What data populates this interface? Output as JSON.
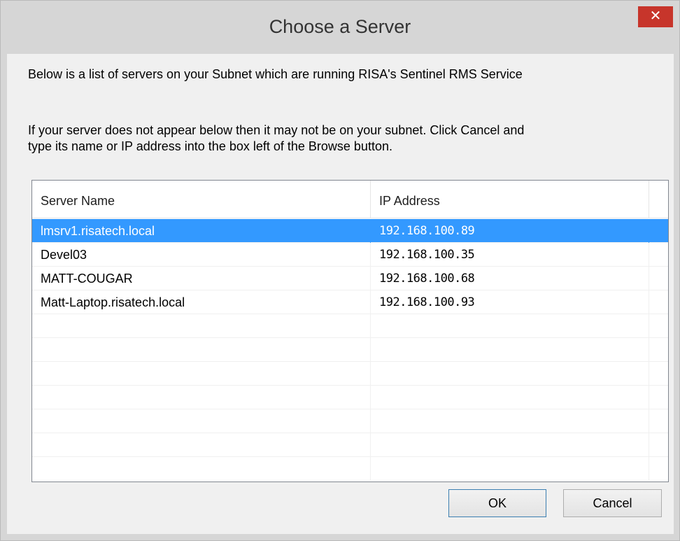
{
  "window": {
    "title": "Choose a Server",
    "close_glyph": "✕",
    "close_icon": "close-icon"
  },
  "messages": {
    "intro": "Below is a list of servers on your Subnet which are running RISA's Sentinel RMS Service",
    "hint_line1": "If your server does not appear below then it may not be on your subnet. Click Cancel and",
    "hint_line2": "type its name or IP address into the box left of the Browse button."
  },
  "list": {
    "columns": [
      "Server Name",
      "IP Address"
    ],
    "rows": [
      {
        "name": "lmsrv1.risatech.local",
        "ip": "192.168.100.89",
        "selected": true
      },
      {
        "name": "Devel03",
        "ip": "192.168.100.35",
        "selected": false
      },
      {
        "name": "MATT-COUGAR",
        "ip": "192.168.100.68",
        "selected": false
      },
      {
        "name": "Matt-Laptop.risatech.local",
        "ip": "192.168.100.93",
        "selected": false
      },
      {
        "name": "",
        "ip": "",
        "selected": false
      },
      {
        "name": "",
        "ip": "",
        "selected": false
      },
      {
        "name": "",
        "ip": "",
        "selected": false
      },
      {
        "name": "",
        "ip": "",
        "selected": false
      },
      {
        "name": "",
        "ip": "",
        "selected": false
      },
      {
        "name": "",
        "ip": "",
        "selected": false
      },
      {
        "name": "",
        "ip": "",
        "selected": false
      }
    ]
  },
  "buttons": {
    "ok_label": "OK",
    "cancel_label": "Cancel"
  },
  "colors": {
    "selection": "#3399ff",
    "close_button": "#c7352b"
  }
}
